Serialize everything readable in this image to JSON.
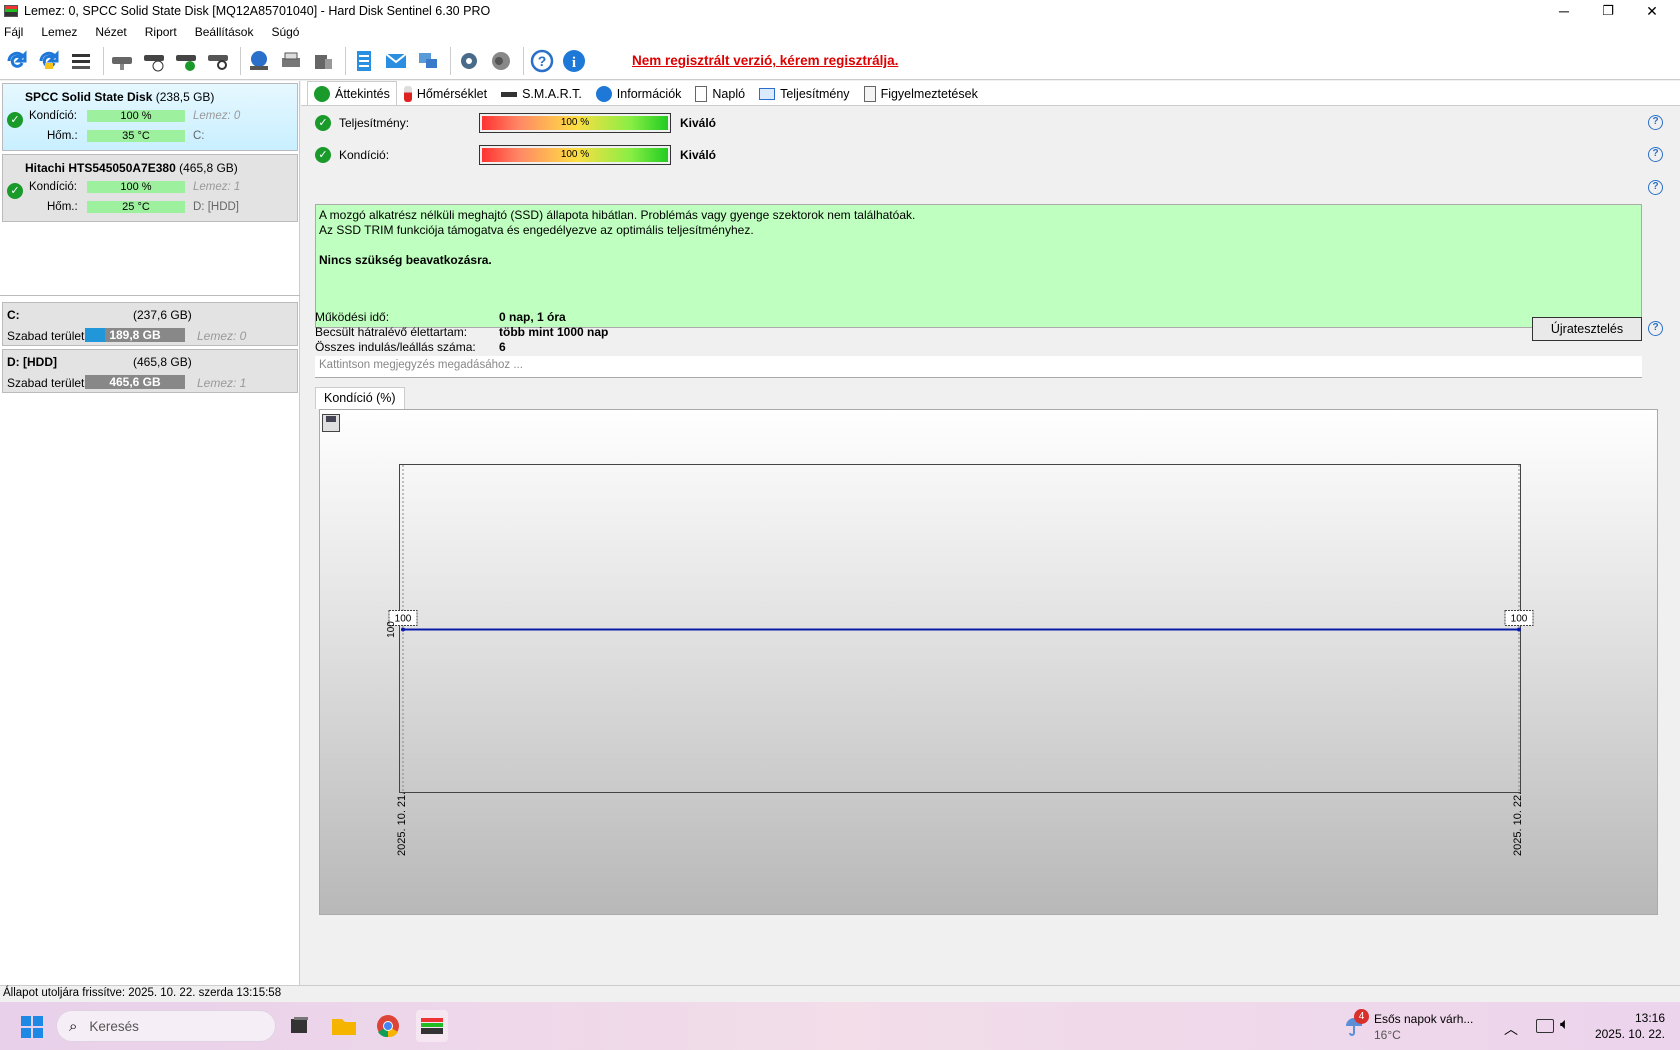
{
  "window": {
    "title": "Lemez: 0, SPCC Solid State Disk [MQ12A85701040]  -  Hard Disk Sentinel 6.30 PRO",
    "minimize": "─",
    "maximize": "❐",
    "close": "✕"
  },
  "menu": [
    "Fájl",
    "Lemez",
    "Nézet",
    "Riport",
    "Beállítások",
    "Súgó"
  ],
  "toolbar": {
    "register_text": "Nem regisztrált verzió, kérem regisztrálja."
  },
  "disks": [
    {
      "name": "SPCC Solid State Disk",
      "size": "(238,5 GB)",
      "health_label": "Kondíció:",
      "health_value": "100 %",
      "health_percent": 100,
      "temp_label": "Hőm.:",
      "temp_value": "35 °C",
      "disk_ref": "Lemez: 0",
      "drive": "C:"
    },
    {
      "name": "Hitachi HTS545050A7E380",
      "size": "(465,8 GB)",
      "health_label": "Kondíció:",
      "health_value": "100 %",
      "health_percent": 100,
      "temp_label": "Hőm.:",
      "temp_value": "25 °C",
      "disk_ref": "Lemez: 1",
      "drive": "D: [HDD]"
    }
  ],
  "volumes": [
    {
      "name": "C:",
      "size": "(237,6 GB)",
      "free_label": "Szabad terület",
      "free_value": "189,8 GB",
      "used_fraction": 0.2,
      "disk_ref": "Lemez: 0"
    },
    {
      "name": "D: [HDD]",
      "size": "(465,8 GB)",
      "free_label": "Szabad terület",
      "free_value": "465,6 GB",
      "used_fraction": 0.0,
      "disk_ref": "Lemez: 1"
    }
  ],
  "tabs": [
    "Áttekintés",
    "Hőmérséklet",
    "S.M.A.R.T.",
    "Információk",
    "Napló",
    "Teljesítmény",
    "Figyelmeztetések"
  ],
  "overview": {
    "performance_label": "Teljesítmény:",
    "performance_value": "100 %",
    "performance_rating": "Kiváló",
    "health_label": "Kondíció:",
    "health_value": "100 %",
    "health_rating": "Kiváló",
    "message_line1": "A mozgó alkatrész nélküli meghajtó (SSD) állapota hibátlan. Problémás vagy gyenge szektorok nem találhatóak.",
    "message_line2": "Az SSD TRIM funkciója támogatva és engedélyezve az optimális teljesítményhez.",
    "message_line3": "Nincs szükség beavatkozásra.",
    "uptime_label": "Működési idő:",
    "uptime_value": "0 nap, 1 óra",
    "lifetime_label": "Becsült hátralévő élettartam:",
    "lifetime_value": "több mint 1000 nap",
    "startstop_label": "Összes indulás/leállás száma:",
    "startstop_value": "6",
    "retest_button": "Újratesztelés",
    "note_placeholder": "Kattintson megjegyzés megadásához ..."
  },
  "chart_tab": "Kondíció  (%)",
  "chart_data": {
    "type": "line",
    "x": [
      "2025. 10. 21.",
      "2025. 10. 22."
    ],
    "series": [
      {
        "values": [
          100,
          100
        ]
      }
    ],
    "y_tick": "100",
    "point_labels": [
      "100",
      "100"
    ],
    "color": "#0a1aa8"
  },
  "statusbar": "Állapot utoljára frissítve: 2025. 10. 22. szerda 13:15:58",
  "taskbar": {
    "search_placeholder": "Keresés",
    "weather_badge": "4",
    "weather_text": "Esős napok várh...",
    "weather_temp": "16°C",
    "time": "13:16",
    "date": "2025. 10. 22."
  }
}
